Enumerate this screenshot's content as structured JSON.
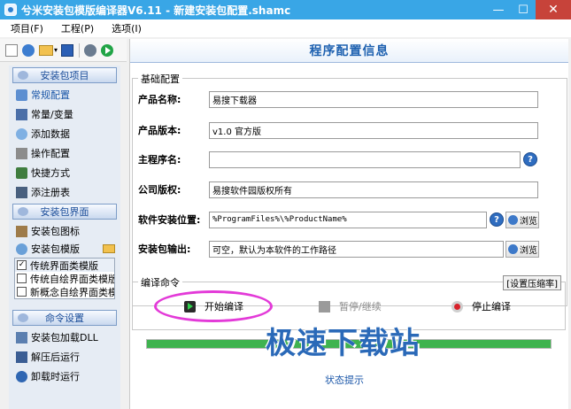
{
  "window": {
    "title": "兮米安装包模版编译器V6.11 - 新建安装包配置.shamc",
    "minimize": "—",
    "maximize": "☐",
    "close": "✕"
  },
  "menu": {
    "items": [
      "项目(F)",
      "工程(P)",
      "选项(I)"
    ]
  },
  "sidebar": {
    "sections": [
      {
        "title": "安装包项目",
        "items": [
          "常规配置",
          "常量/变量",
          "添加数据",
          "操作配置",
          "快捷方式",
          "添注册表"
        ]
      },
      {
        "title": "安装包界面",
        "items": [
          "安装包图标",
          "安装包模版"
        ],
        "templates": [
          {
            "label": "传统界面类模版",
            "checked": true
          },
          {
            "label": "传统自绘界面类模版",
            "checked": false
          },
          {
            "label": "新概念自绘界面类模版",
            "checked": false
          }
        ]
      },
      {
        "title": "命令设置",
        "items": [
          "安装包加载DLL",
          "解压后运行",
          "卸载时运行"
        ]
      }
    ]
  },
  "main": {
    "header": "程序配置信息",
    "basic": {
      "group_title": "基础配置",
      "product_name": {
        "label": "产品名称:",
        "value": "易搜下载器"
      },
      "product_version": {
        "label": "产品版本:",
        "value": "v1.0 官方版"
      },
      "main_program": {
        "label": "主程序名:",
        "value": ""
      },
      "copyright": {
        "label": "公司版权:",
        "value": "易搜软件园版权所有"
      },
      "install_path": {
        "label": "软件安装位置:",
        "value": "%ProgramFiles%\\%ProductName%"
      },
      "output": {
        "label": "安装包输出:",
        "value": "可空，默认为本软件的工作路径"
      },
      "help_glyph": "?",
      "browse_label": "浏览"
    },
    "commands": {
      "group_title": "编译命令",
      "compress_button": "[设置压缩率]",
      "start": "开始编译",
      "pause": "暂停/继续",
      "stop": "停止编译"
    },
    "progress": 1.0,
    "status": "状态提示"
  },
  "watermark": "极速下载站",
  "colors": {
    "titlebar": "#39a6e6",
    "accent_text": "#1e61b0",
    "highlight_ellipse": "#e33ad8",
    "progress": "#3fb34f"
  }
}
